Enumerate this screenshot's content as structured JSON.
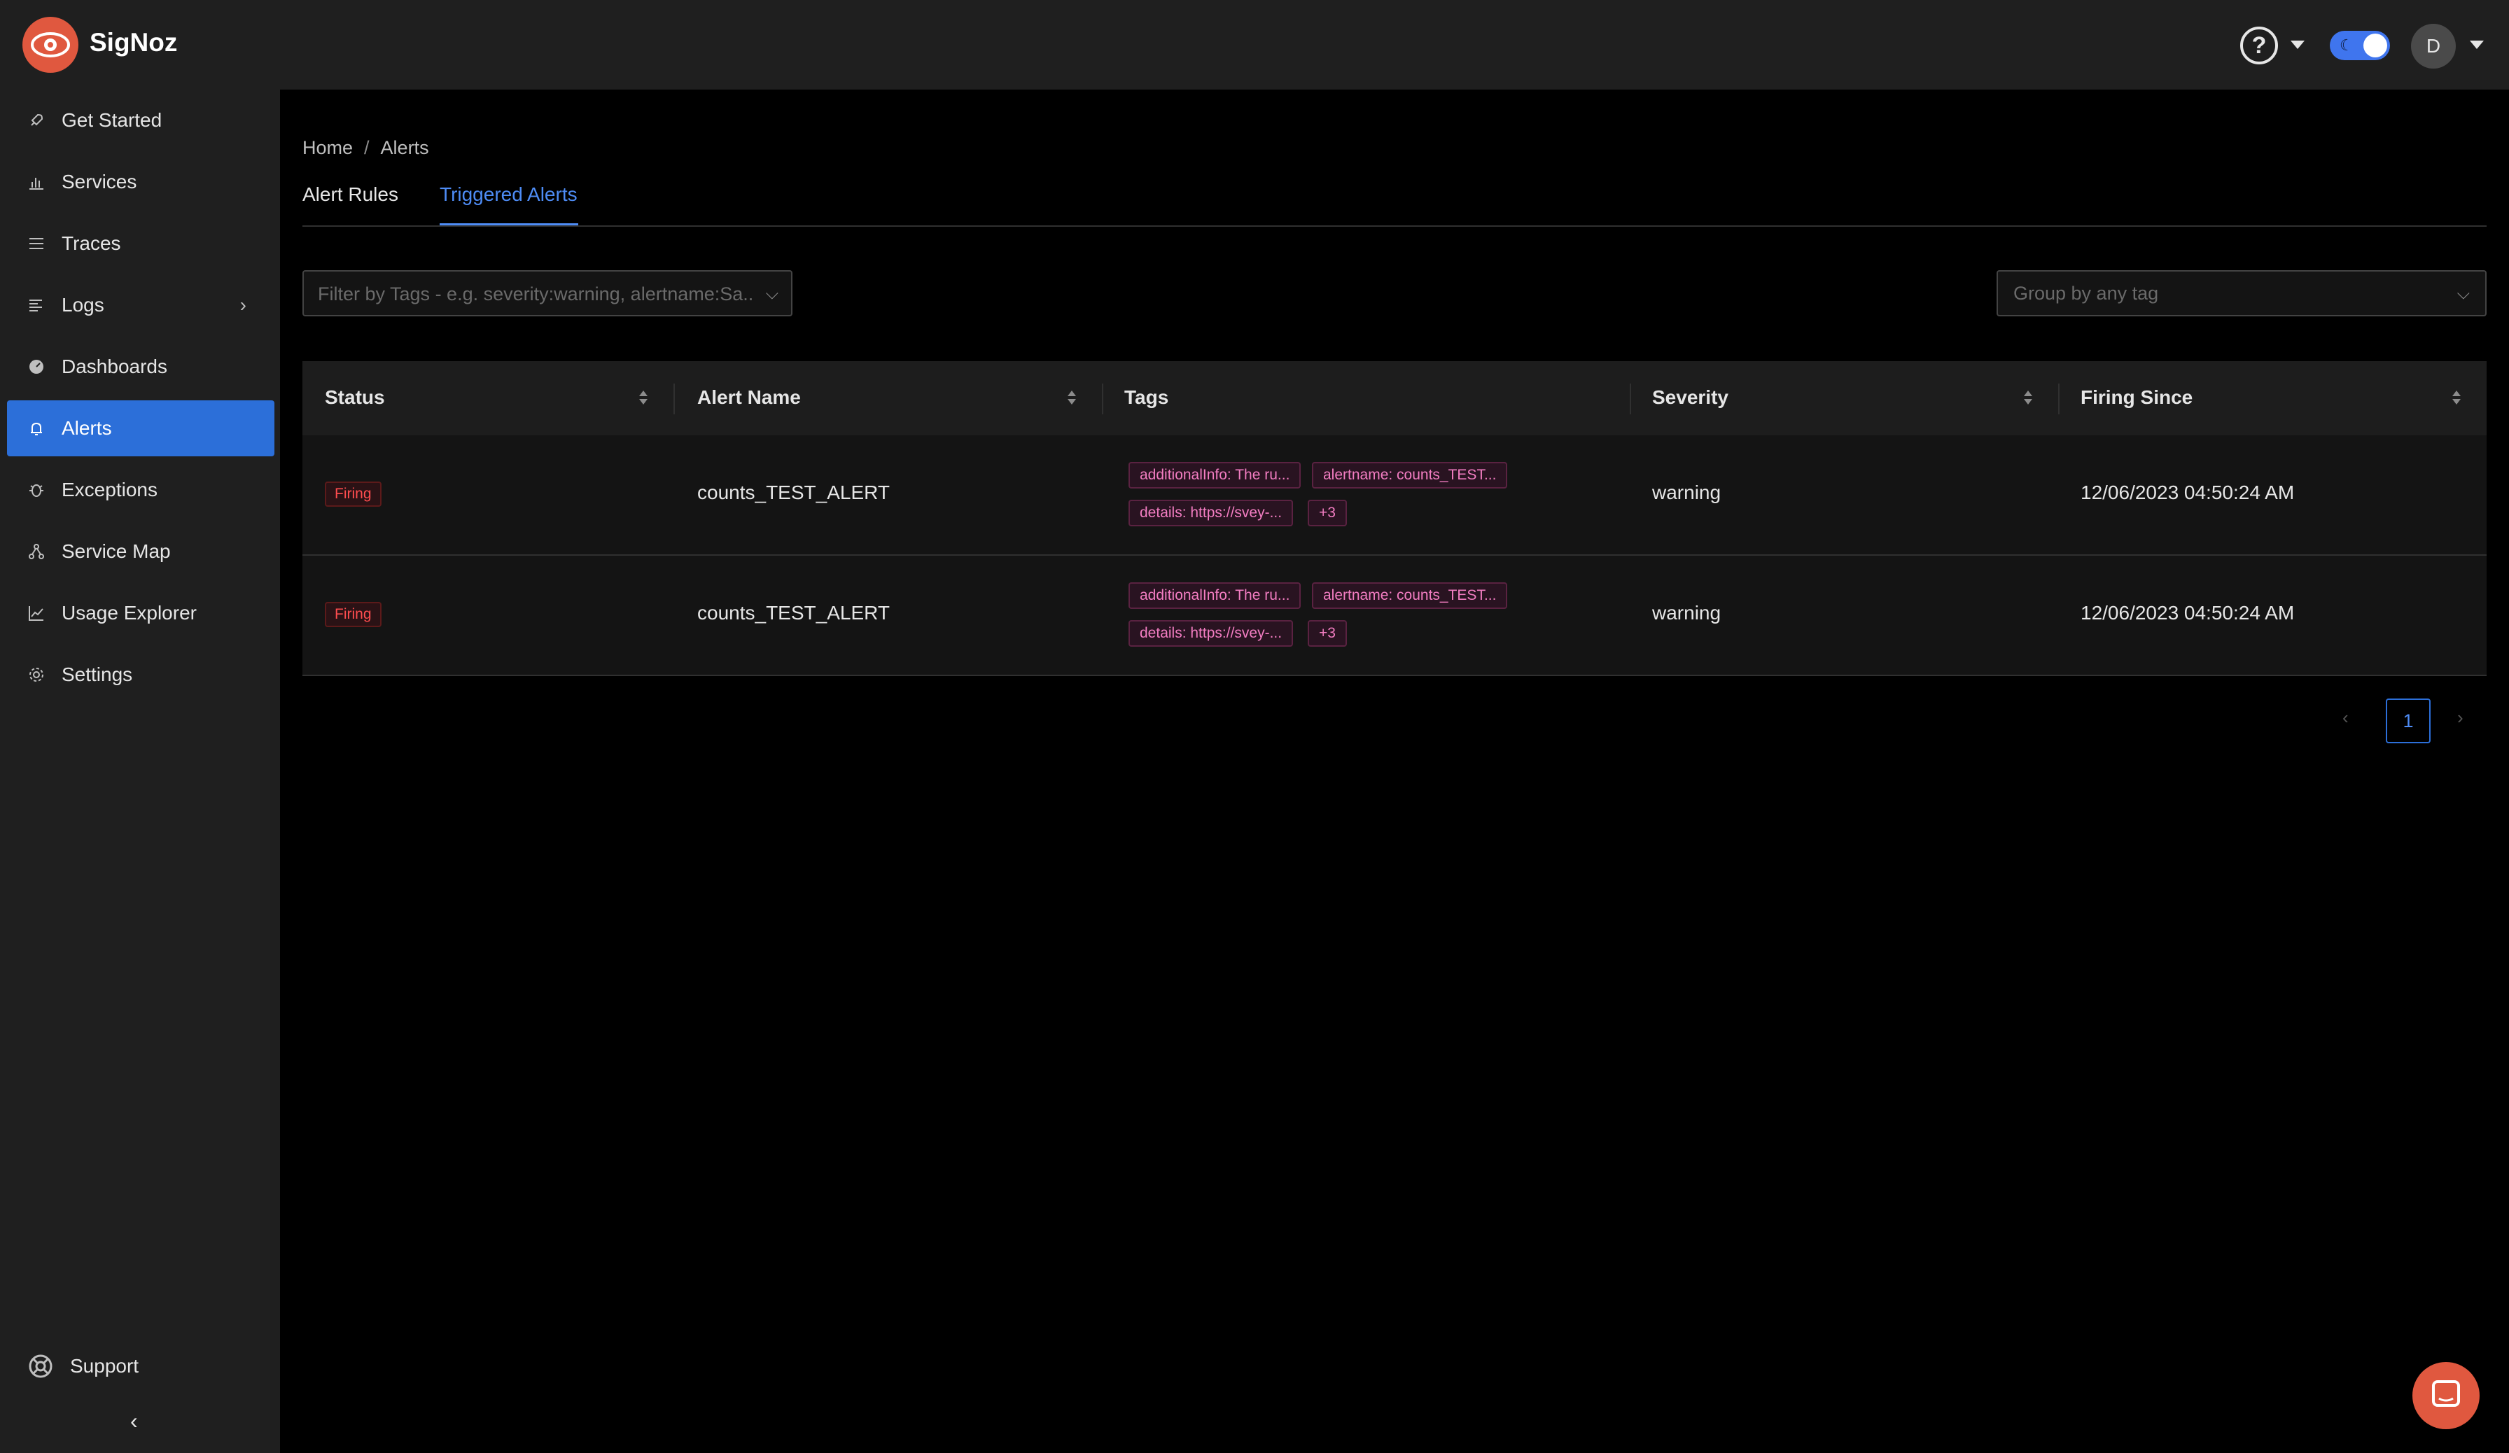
{
  "header": {
    "brand": "SigNoz",
    "user_initial": "D",
    "brand_color": "#e0583f"
  },
  "sidebar": {
    "items": [
      {
        "label": "Get Started",
        "icon": "rocket-icon"
      },
      {
        "label": "Services",
        "icon": "bar-chart-icon"
      },
      {
        "label": "Traces",
        "icon": "menu-icon"
      },
      {
        "label": "Logs",
        "icon": "align-left-icon"
      },
      {
        "label": "Dashboards",
        "icon": "dashboard-icon"
      },
      {
        "label": "Alerts",
        "icon": "bell-icon"
      },
      {
        "label": "Exceptions",
        "icon": "bug-icon"
      },
      {
        "label": "Service Map",
        "icon": "deployment-unit-icon"
      },
      {
        "label": "Usage Explorer",
        "icon": "line-chart-icon"
      },
      {
        "label": "Settings",
        "icon": "gear-icon"
      }
    ],
    "active": "Alerts",
    "support_label": "Support",
    "active_color": "#2c6fd9"
  },
  "breadcrumb": {
    "home": "Home",
    "current": "Alerts"
  },
  "tabs": {
    "alert_rules": "Alert Rules",
    "triggered_alerts": "Triggered Alerts",
    "active": "Triggered Alerts"
  },
  "filter": {
    "placeholder": "Filter by Tags - e.g. severity:warning, alertname:Sa...",
    "group_placeholder": "Group by any tag"
  },
  "table": {
    "columns": [
      "Status",
      "Alert Name",
      "Tags",
      "Severity",
      "Firing Since"
    ],
    "rows": [
      {
        "status": "Firing",
        "alert_name": "counts_TEST_ALERT",
        "tags": [
          "additionalInfo: The ru...",
          "alertname: counts_TEST...",
          "details: https://svey-...",
          "+3"
        ],
        "severity": "warning",
        "firing_since": "12/06/2023 04:50:24 AM"
      },
      {
        "status": "Firing",
        "alert_name": "counts_TEST_ALERT",
        "tags": [
          "additionalInfo: The ru...",
          "alertname: counts_TEST...",
          "details: https://svey-...",
          "+3"
        ],
        "severity": "warning",
        "firing_since": "12/06/2023 04:50:24 AM"
      }
    ]
  },
  "pagination": {
    "current_page": "1"
  },
  "colors": {
    "firing": "#ff4d4f",
    "tag": "#f37dc2",
    "link": "#4e8cf5"
  }
}
